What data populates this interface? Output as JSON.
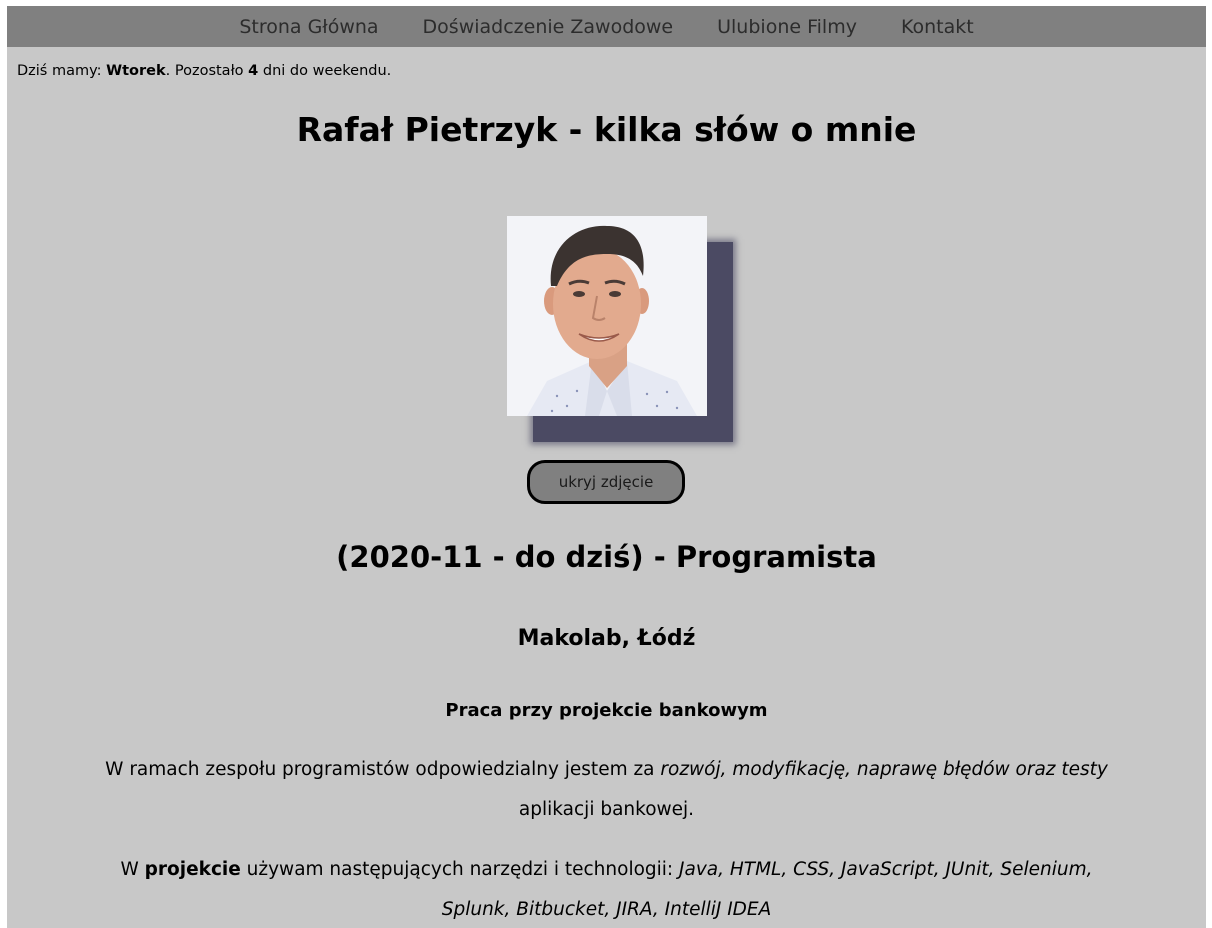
{
  "nav": {
    "items": [
      "Strona Główna",
      "Doświadczenie Zawodowe",
      "Ulubione Filmy",
      "Kontakt"
    ]
  },
  "dayline": {
    "prefix": "Dziś mamy: ",
    "day": "Wtorek",
    "middle": ". Pozostało ",
    "count": "4",
    "suffix": " dni do weekendu."
  },
  "header": {
    "title": "Rafał Pietrzyk - kilka słów o mnie"
  },
  "photo": {
    "button_label": "ukryj zdjęcie"
  },
  "job": {
    "title": "(2020-11 - do dziś) - Programista",
    "company": "Makolab, Łódź",
    "project": "Praca przy projekcie bankowym",
    "desc_prefix": "W ramach zespołu programistów odpowiedzialny jestem za ",
    "desc_italic": "rozwój, modyfikację, naprawę błędów oraz testy",
    "desc_suffix": " aplikacji bankowej.",
    "tools_prefix": "W ",
    "tools_bold": "projekcie",
    "tools_middle": " używam następujących narzędzi i technologii: ",
    "tools_italic": "Java, HTML, CSS, JavaScript, JUnit, Selenium, Splunk, Bitbucket, JIRA, IntelliJ IDEA"
  },
  "colors": {
    "page_bg": "#c8c8c8",
    "nav_bg": "#808080",
    "photo_shadow": "#4b4a63",
    "button_bg": "#808080"
  }
}
